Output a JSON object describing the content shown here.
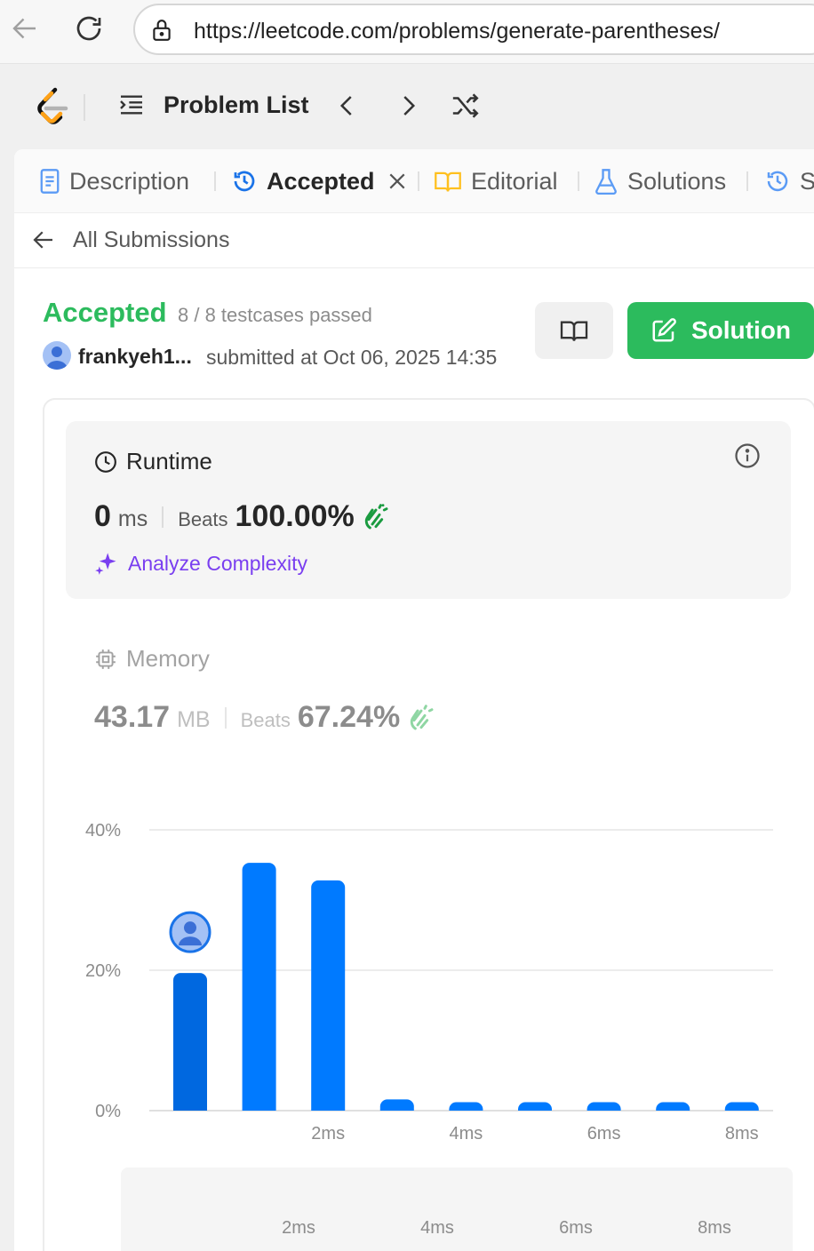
{
  "browser": {
    "url": "https://leetcode.com/problems/generate-parentheses/"
  },
  "header": {
    "problem_list_label": "Problem List"
  },
  "tabs": [
    {
      "label": "Description",
      "icon": "document-icon"
    },
    {
      "label": "Accepted",
      "icon": "history-icon"
    },
    {
      "label": "Editorial",
      "icon": "book-open-icon"
    },
    {
      "label": "Solutions",
      "icon": "flask-icon"
    },
    {
      "label": "S",
      "icon": "history-icon"
    }
  ],
  "subheader": {
    "back_label": "All Submissions"
  },
  "submission": {
    "status": "Accepted",
    "testcases": "8 / 8 testcases passed",
    "user": "frankyeh1...",
    "submitted": "submitted at Oct 06, 2025 14:35",
    "solution_button": "Solution"
  },
  "runtime": {
    "title": "Runtime",
    "value": "0",
    "unit": "ms",
    "beats_label": "Beats",
    "beats": "100.00%",
    "analyze_label": "Analyze Complexity"
  },
  "memory": {
    "title": "Memory",
    "value": "43.17",
    "unit": "MB",
    "beats_label": "Beats",
    "beats": "67.24%"
  },
  "colors": {
    "accepted": "#2cbb5d",
    "bar": "#007aff",
    "bar_user": "#0068e0",
    "analyze": "#7a3ff0"
  },
  "chart_data": {
    "type": "bar",
    "ylim": [
      0,
      40
    ],
    "yticks": [
      "40%",
      "20%",
      "0%"
    ],
    "ytick_values": [
      40,
      20,
      0
    ],
    "xtick_labels": [
      "2ms",
      "4ms",
      "6ms",
      "8ms"
    ],
    "xtick_positions": [
      2,
      4,
      6,
      8
    ],
    "values": [
      19.6,
      35.3,
      32.8,
      1.6,
      1.2,
      1.2,
      1.2,
      1.2,
      1.2
    ],
    "user_bar_index": 0,
    "grid": true
  }
}
